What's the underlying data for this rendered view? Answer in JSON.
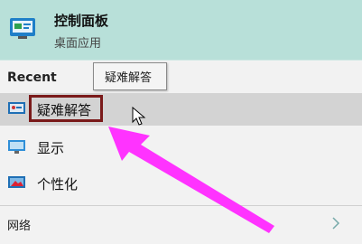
{
  "header": {
    "title": "控制面板",
    "subtitle": "桌面应用",
    "icon": "control-panel-icon"
  },
  "recent": {
    "label": "Recent",
    "tooltip": "疑难解答",
    "items": [
      {
        "label": "疑难解答",
        "icon": "troubleshoot-icon"
      },
      {
        "label": "显示",
        "icon": "display-icon"
      },
      {
        "label": "个性化",
        "icon": "personalize-icon"
      }
    ]
  },
  "network": {
    "label": "网络",
    "icon": "chevron-right-icon"
  },
  "colors": {
    "accent": "#ff33ff",
    "highlight_border": "#7a1a1a",
    "header_bg": "#b8e0d9"
  }
}
